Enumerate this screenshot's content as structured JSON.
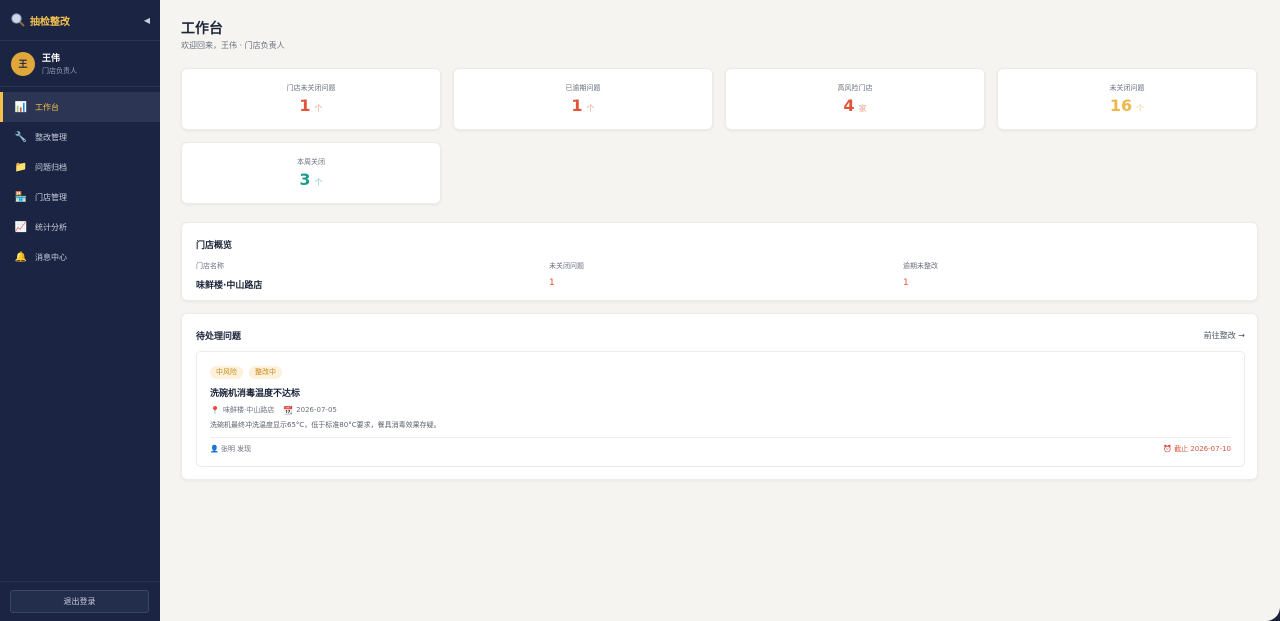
{
  "app": {
    "brand": "抽检整改",
    "collapse_icon": "◀"
  },
  "user": {
    "avatar": "王",
    "name": "王伟",
    "role": "门店负责人"
  },
  "nav": [
    {
      "icon": "📊",
      "label": "工作台"
    },
    {
      "icon": "🔧",
      "label": "整改管理"
    },
    {
      "icon": "📁",
      "label": "问题归档"
    },
    {
      "icon": "🏪",
      "label": "门店管理"
    },
    {
      "icon": "📈",
      "label": "统计分析"
    },
    {
      "icon": "🔔",
      "label": "消息中心"
    }
  ],
  "logout_label": "退出登录",
  "page": {
    "title": "工作台",
    "welcome": "欢迎回来，王伟 · 门店负责人"
  },
  "stats": [
    {
      "label": "门店未关闭问题",
      "value": "1",
      "unit": "个",
      "color": "#e2543a"
    },
    {
      "label": "已逾期问题",
      "value": "1",
      "unit": "个",
      "color": "#e2543a"
    },
    {
      "label": "高风险门店",
      "value": "4",
      "unit": "家",
      "color": "#e2543a"
    },
    {
      "label": "未关闭问题",
      "value": "16",
      "unit": "个",
      "color": "#f0b84a"
    },
    {
      "label": "本周关闭",
      "value": "3",
      "unit": "个",
      "color": "#1f9e8f"
    }
  ],
  "overview": {
    "title": "门店概览",
    "headers": [
      "门店名称",
      "未关闭问题",
      "逾期未整改"
    ],
    "store_name": "味鲜楼·中山路店",
    "open_issues": "1",
    "overdue": "1"
  },
  "pending": {
    "title": "待处理问题",
    "goto_label": "前往整改 →",
    "issue": {
      "risk_tag": "中风险",
      "status_tag": "整改中",
      "title": "洗碗机消毒温度不达标",
      "store": "味鲜楼·中山路店",
      "date": "2026-07-05",
      "description": "洗碗机最终冲洗温度显示65°C，低于标准80°C要求，餐具消毒效果存疑。",
      "reporter": "张明 发现",
      "deadline": "截止 2026-07-10"
    }
  },
  "colors": {
    "accent": "#f3c04d",
    "sidebar": "#1b2443",
    "danger": "#e2543a",
    "warning": "#f0b84a",
    "success": "#1f9e8f"
  }
}
